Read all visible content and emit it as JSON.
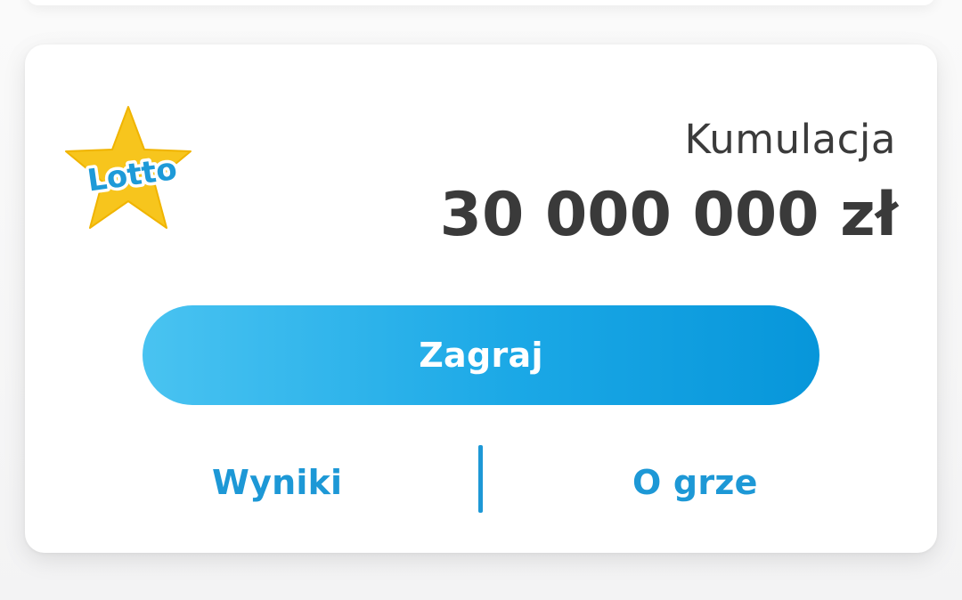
{
  "logo": {
    "text": "Lotto",
    "icon": "lotto-star-logo",
    "star_color": "#f7c51d",
    "text_color": "#1e9ad8"
  },
  "jackpot": {
    "label": "Kumulacja",
    "amount": "30 000 000 zł"
  },
  "actions": {
    "play_label": "Zagraj",
    "results_label": "Wyniki",
    "about_label": "O grze"
  },
  "colors": {
    "accent": "#1d98d6",
    "button_gradient_start": "#49c3f1",
    "button_gradient_end": "#0796da",
    "text_dark": "#3a3a3a",
    "card_background": "#ffffff"
  }
}
